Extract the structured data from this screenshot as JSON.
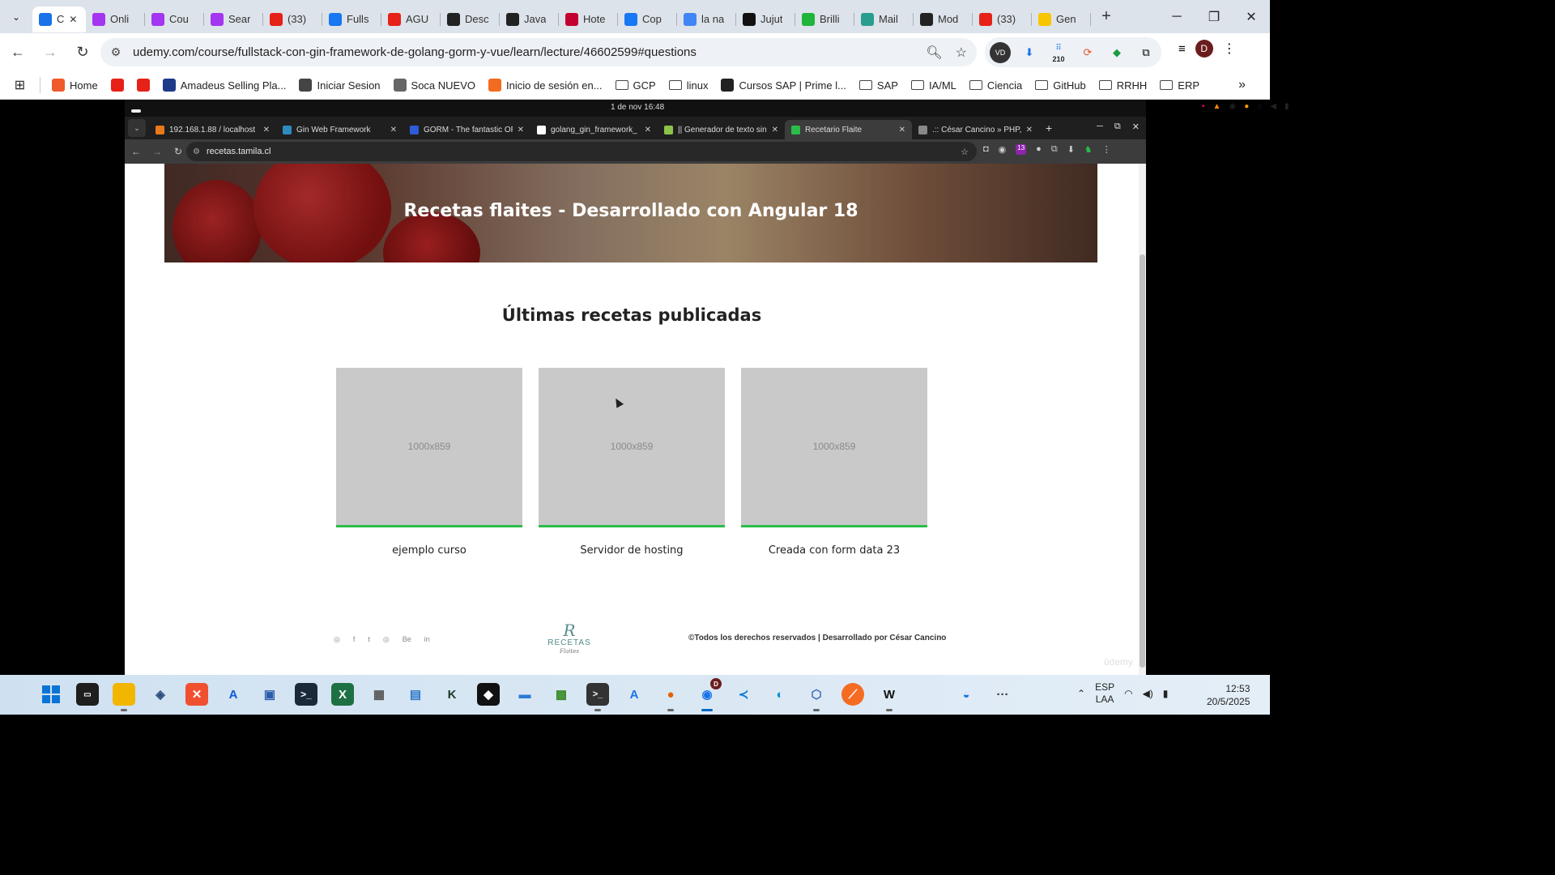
{
  "browser": {
    "tabs": [
      {
        "title": "C",
        "color": "#1a73e8",
        "active": true
      },
      {
        "title": "Onli",
        "color": "#a435f0"
      },
      {
        "title": "Cou",
        "color": "#a435f0"
      },
      {
        "title": "Sear",
        "color": "#a435f0"
      },
      {
        "title": "(33)",
        "color": "#e62117"
      },
      {
        "title": "Fulls",
        "color": "#1877f2"
      },
      {
        "title": "AGU",
        "color": "#e62117"
      },
      {
        "title": "Desc",
        "color": "#222222"
      },
      {
        "title": "Java",
        "color": "#222222"
      },
      {
        "title": "Hote",
        "color": "#c3002f"
      },
      {
        "title": "Cop",
        "color": "#1877f2"
      },
      {
        "title": "la na",
        "color": "#4285f4"
      },
      {
        "title": "Jujut",
        "color": "#111111"
      },
      {
        "title": "Brilli",
        "color": "#1fb53a"
      },
      {
        "title": "Mail",
        "color": "#2a9d8f"
      },
      {
        "title": "Mod",
        "color": "#222222"
      },
      {
        "title": "(33)",
        "color": "#e62117"
      },
      {
        "title": "Gen",
        "color": "#f7c600"
      }
    ],
    "url": "udemy.com/course/fullstack-con-gin-framework-de-golang-gorm-y-vue/learn/lecture/46602599#questions",
    "ext_badge": "210",
    "avatar_letter": "D",
    "bookmarks": [
      {
        "label": "Home",
        "icon": "#ef5a2a"
      },
      {
        "label": "",
        "icon": "#e62117"
      },
      {
        "label": "",
        "icon": "#e62117"
      },
      {
        "label": "Amadeus Selling Pla...",
        "icon": "#1e3a8a"
      },
      {
        "label": "Iniciar Sesion",
        "icon": "#444444"
      },
      {
        "label": "Soca NUEVO",
        "icon": "#666666"
      },
      {
        "label": "Inicio de sesión en...",
        "icon": "#f26b21"
      },
      {
        "label": "GCP",
        "folder": true
      },
      {
        "label": "linux",
        "folder": true
      },
      {
        "label": "Cursos SAP | Prime l...",
        "icon": "#222222"
      },
      {
        "label": "SAP",
        "folder": true
      },
      {
        "label": "IA/ML",
        "folder": true
      },
      {
        "label": "Ciencia",
        "folder": true
      },
      {
        "label": "GitHub",
        "folder": true
      },
      {
        "label": "RRHH",
        "folder": true
      },
      {
        "label": "ERP",
        "folder": true
      }
    ]
  },
  "remote": {
    "clock": "1 de nov  16:48",
    "tabs": [
      {
        "title": "192.168.1.88 / localhost",
        "color": "#e87a1a"
      },
      {
        "title": "Gin Web Framework",
        "color": "#2e8bc0"
      },
      {
        "title": "GORM - The fantastic OR",
        "color": "#2e5bd8"
      },
      {
        "title": "golang_gin_framework_",
        "color": "#ffffff"
      },
      {
        "title": "|| Generador de texto sin",
        "color": "#8bc34a"
      },
      {
        "title": "Recetario Flaite",
        "color": "#2bbd4a",
        "active": true
      },
      {
        "title": ".:: César Cancino » PHP, l",
        "color": "#888888"
      }
    ],
    "url": "recetas.tamila.cl",
    "ext_badge": "13"
  },
  "page": {
    "hero_title": "Recetas flaites - Desarrollado con Angular 18",
    "section_title": "Últimas recetas publicadas",
    "cards": [
      {
        "placeholder": "1000x859",
        "caption": "ejemplo curso"
      },
      {
        "placeholder": "1000x859",
        "caption": "Servidor de hosting"
      },
      {
        "placeholder": "1000x859",
        "caption": "Creada con form data 23"
      }
    ],
    "logo_mono": "R",
    "logo_word": "RECETAS",
    "logo_sub": "Flaites",
    "copyright": "©Todos los derechos reservados | Desarrollado por César Cancino",
    "social": [
      "◎",
      "f",
      "t",
      "◎",
      "Be",
      "in"
    ],
    "watermark": "ûdemy"
  },
  "taskbar": {
    "lang1": "ESP",
    "lang2": "LAA",
    "time": "12:53",
    "date": "20/5/2025",
    "chrome_badge": "D"
  }
}
